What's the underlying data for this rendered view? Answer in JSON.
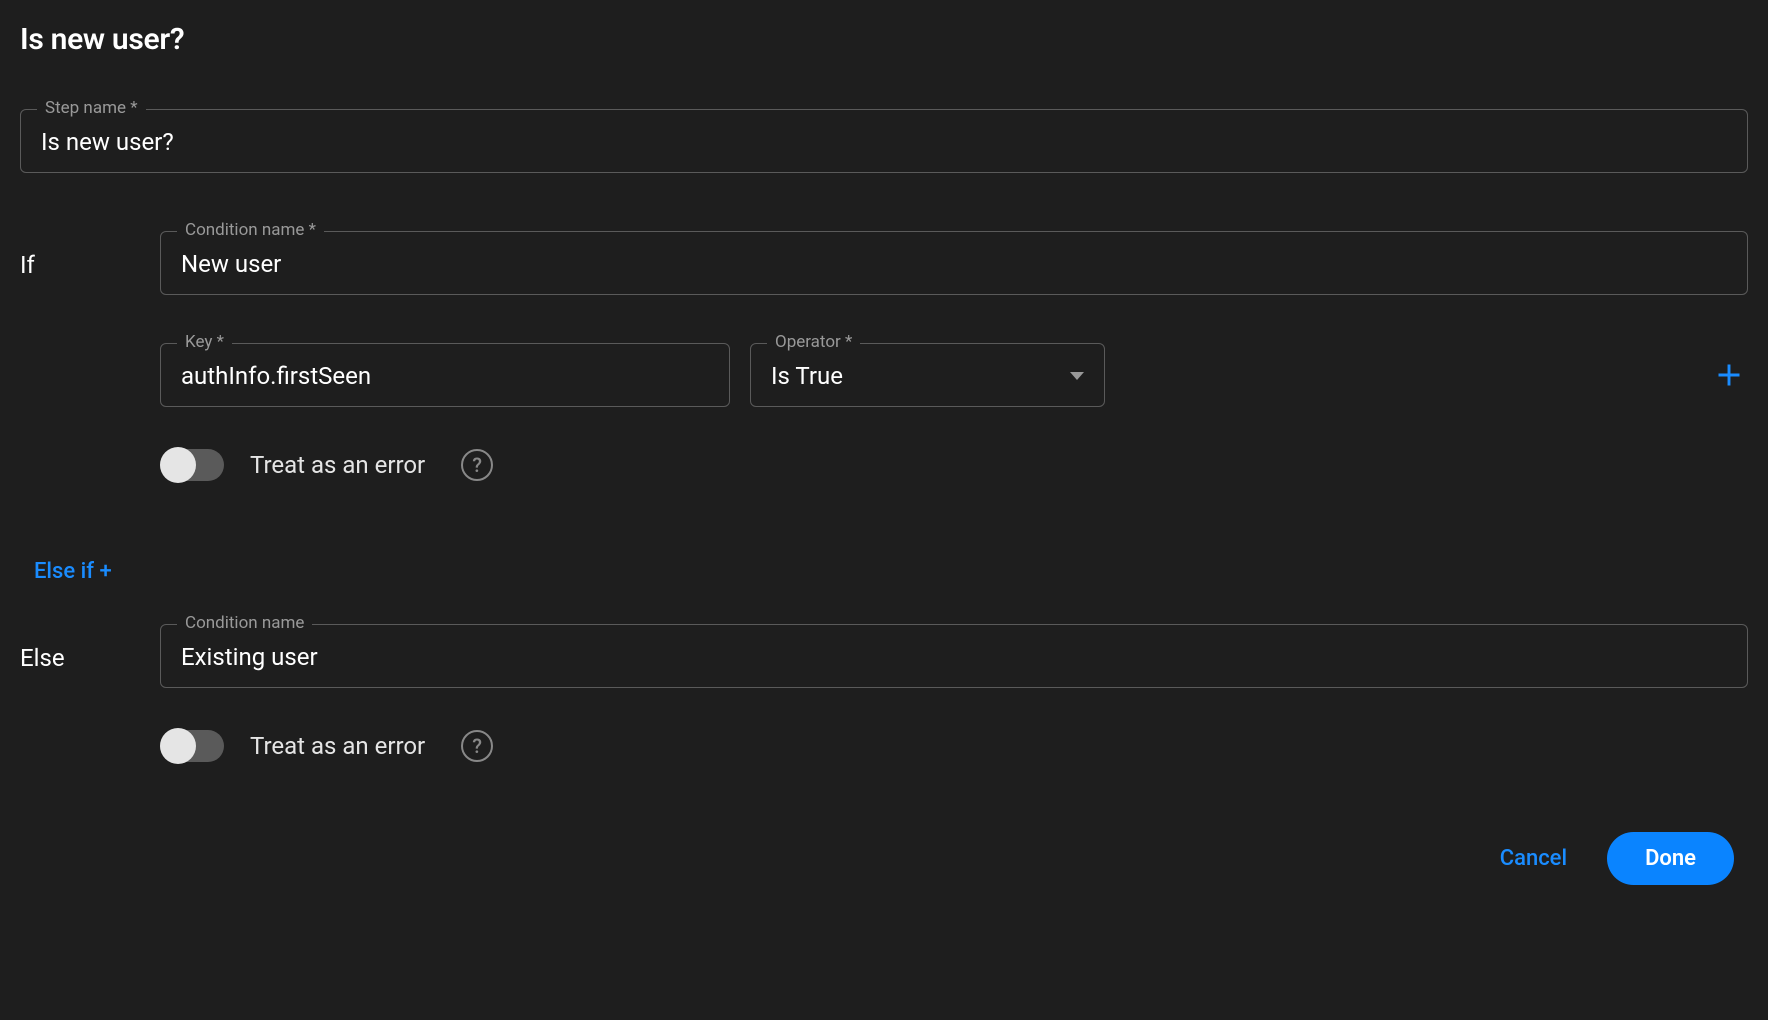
{
  "title": "Is new user?",
  "step_name": {
    "label": "Step name *",
    "value": "Is new user?"
  },
  "if_section": {
    "label": "If",
    "condition_name": {
      "label": "Condition name *",
      "value": "New user"
    },
    "key": {
      "label": "Key *",
      "value": "authInfo.firstSeen"
    },
    "operator": {
      "label": "Operator *",
      "value": "Is True"
    },
    "treat_error": {
      "label": "Treat as an error",
      "checked": false
    }
  },
  "else_if_link": "Else if +",
  "else_section": {
    "label": "Else",
    "condition_name": {
      "label": "Condition name",
      "value": "Existing user"
    },
    "treat_error": {
      "label": "Treat as an error",
      "checked": false
    }
  },
  "footer": {
    "cancel": "Cancel",
    "done": "Done"
  }
}
